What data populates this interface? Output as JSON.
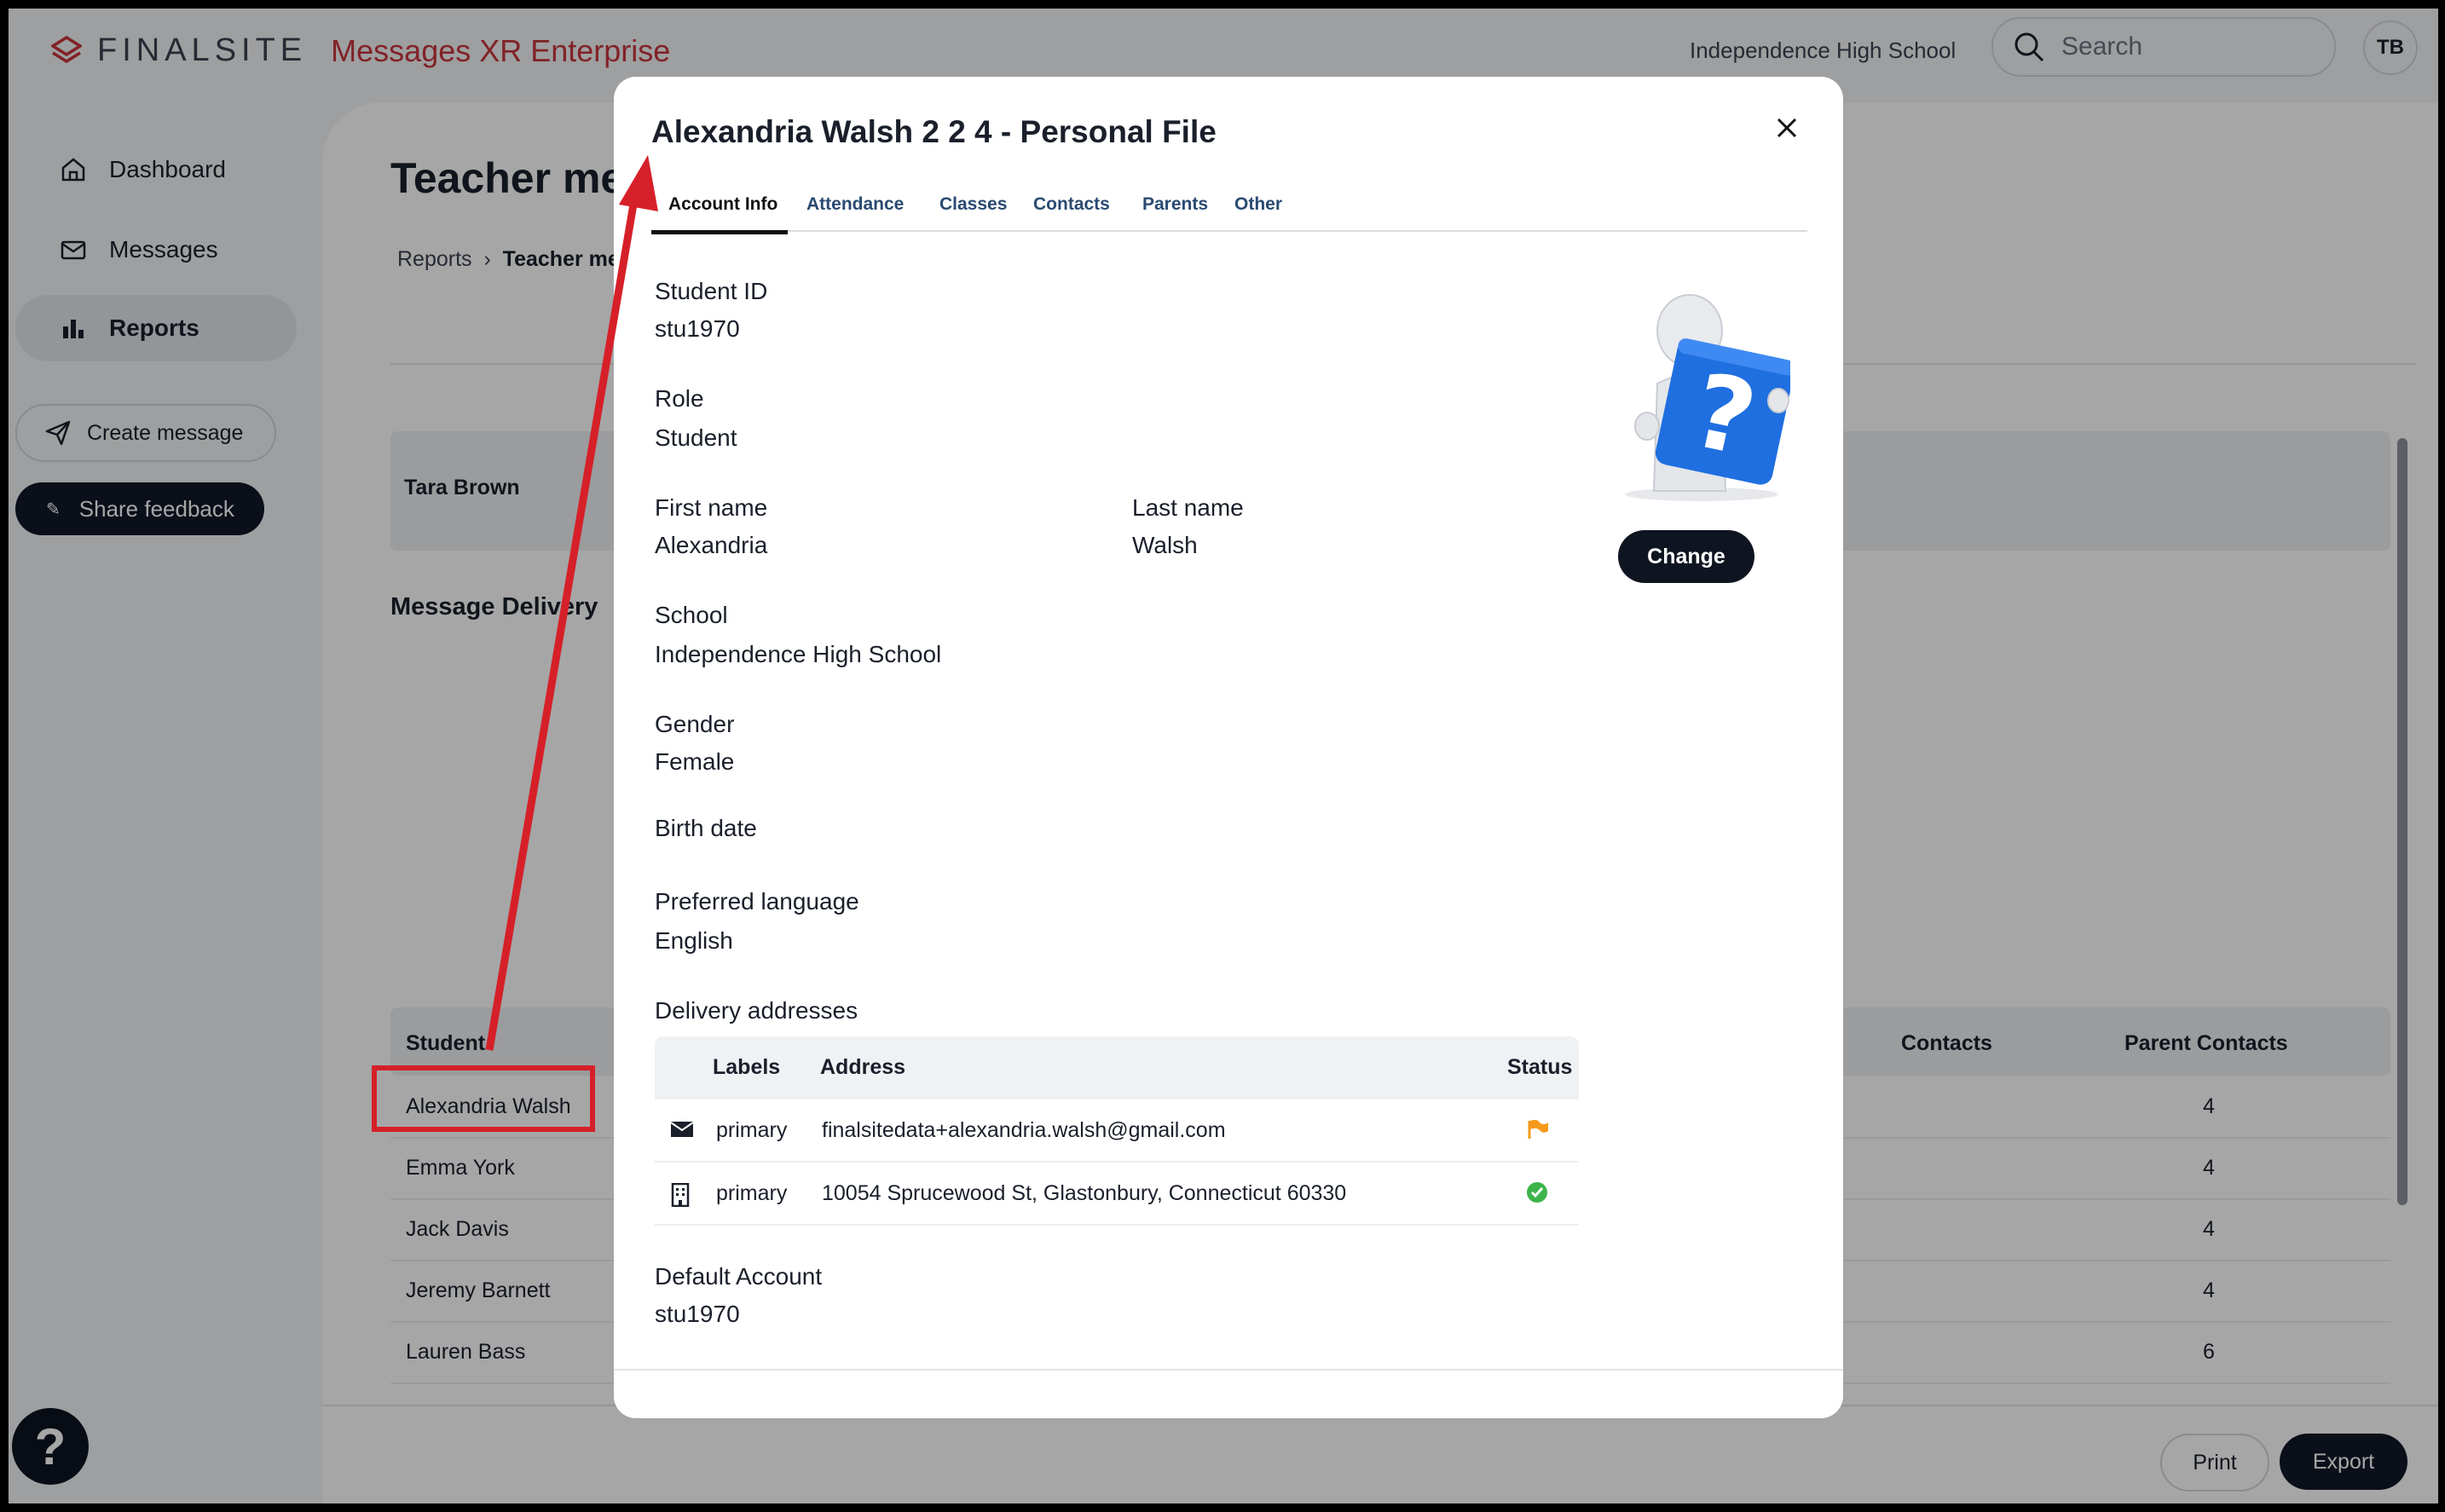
{
  "app": {
    "brand": "FINALSITE",
    "product": "Messages XR Enterprise",
    "school": "Independence High School",
    "search_placeholder": "Search",
    "user_initials": "TB"
  },
  "sidebar": {
    "items": [
      {
        "label": "Dashboard",
        "icon": "home-icon"
      },
      {
        "label": "Messages",
        "icon": "envelope-icon"
      },
      {
        "label": "Reports",
        "icon": "bar-chart-icon",
        "active": true
      }
    ],
    "create_message": "Create message",
    "share_feedback": "Share feedback",
    "help": "?"
  },
  "page": {
    "title": "Teacher mes",
    "breadcrumb": {
      "root": "Reports",
      "current": "Teacher mes"
    },
    "teacher_name": "Tara Brown",
    "section_title": "Message Delivery",
    "table": {
      "headers": [
        "Student",
        "Contacts",
        "Parent Contacts"
      ],
      "rows": [
        {
          "student": "Alexandria Walsh",
          "parent_contacts": "4"
        },
        {
          "student": "Emma York",
          "parent_contacts": "4"
        },
        {
          "student": "Jack Davis",
          "parent_contacts": "4"
        },
        {
          "student": "Jeremy Barnett",
          "parent_contacts": "4"
        },
        {
          "student": "Lauren Bass",
          "parent_contacts": "6"
        }
      ]
    },
    "print": "Print",
    "export": "Export"
  },
  "modal": {
    "title": "Alexandria Walsh 2 2 4 - Personal File",
    "tabs": [
      "Account Info",
      "Attendance",
      "Classes",
      "Contacts",
      "Parents",
      "Other"
    ],
    "active_tab": "Account Info",
    "fields": {
      "student_id": {
        "label": "Student ID",
        "value": "stu1970"
      },
      "role": {
        "label": "Role",
        "value": "Student"
      },
      "first_name": {
        "label": "First name",
        "value": "Alexandria"
      },
      "last_name": {
        "label": "Last name",
        "value": "Walsh"
      },
      "school": {
        "label": "School",
        "value": "Independence High School"
      },
      "gender": {
        "label": "Gender",
        "value": "Female"
      },
      "birth_date": {
        "label": "Birth date",
        "value": ""
      },
      "preferred_language": {
        "label": "Preferred language",
        "value": "English"
      },
      "default_account": {
        "label": "Default Account",
        "value": "stu1970"
      }
    },
    "change_button": "Change",
    "delivery": {
      "label": "Delivery addresses",
      "headers": {
        "labels": "Labels",
        "address": "Address",
        "status": "Status"
      },
      "rows": [
        {
          "icon": "envelope-icon",
          "label": "primary",
          "address": "finalsitedata+alexandria.walsh@gmail.com",
          "status": "flag",
          "status_color": "#f59a1b"
        },
        {
          "icon": "building-icon",
          "label": "primary",
          "address": "10054 Sprucewood St, Glastonbury, Connecticut 60330",
          "status": "ok",
          "status_color": "#3cb44b"
        }
      ]
    }
  },
  "annotation_color": "#d62029"
}
